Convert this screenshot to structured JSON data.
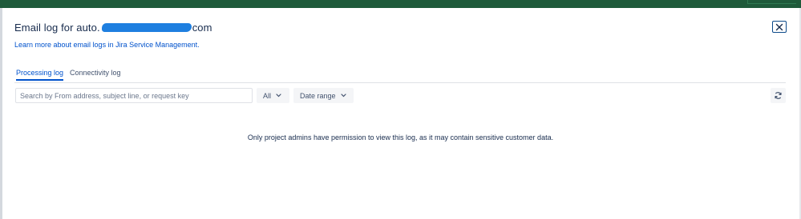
{
  "dialog": {
    "title_prefix": "Email log for auto.",
    "title_suffix": "com",
    "learn_more": "Learn more about email logs in Jira Service Management."
  },
  "tabs": [
    {
      "label": "Processing log",
      "active": true
    },
    {
      "label": "Connectivity log",
      "active": false
    }
  ],
  "toolbar": {
    "search_placeholder": "Search by From address, subject line, or request key",
    "status_filter": "All",
    "date_filter": "Date range"
  },
  "empty_state": {
    "message": "Only project admins have permission to view this log, as it may contain sensitive customer data."
  },
  "icons": {
    "close": "close-icon",
    "refresh": "refresh-icon",
    "chevron": "chevron-down-icon"
  },
  "colors": {
    "accent": "#0052cc",
    "text": "#172b4d",
    "topbar": "#1e5a3a",
    "redaction": "#1e7fe0"
  }
}
